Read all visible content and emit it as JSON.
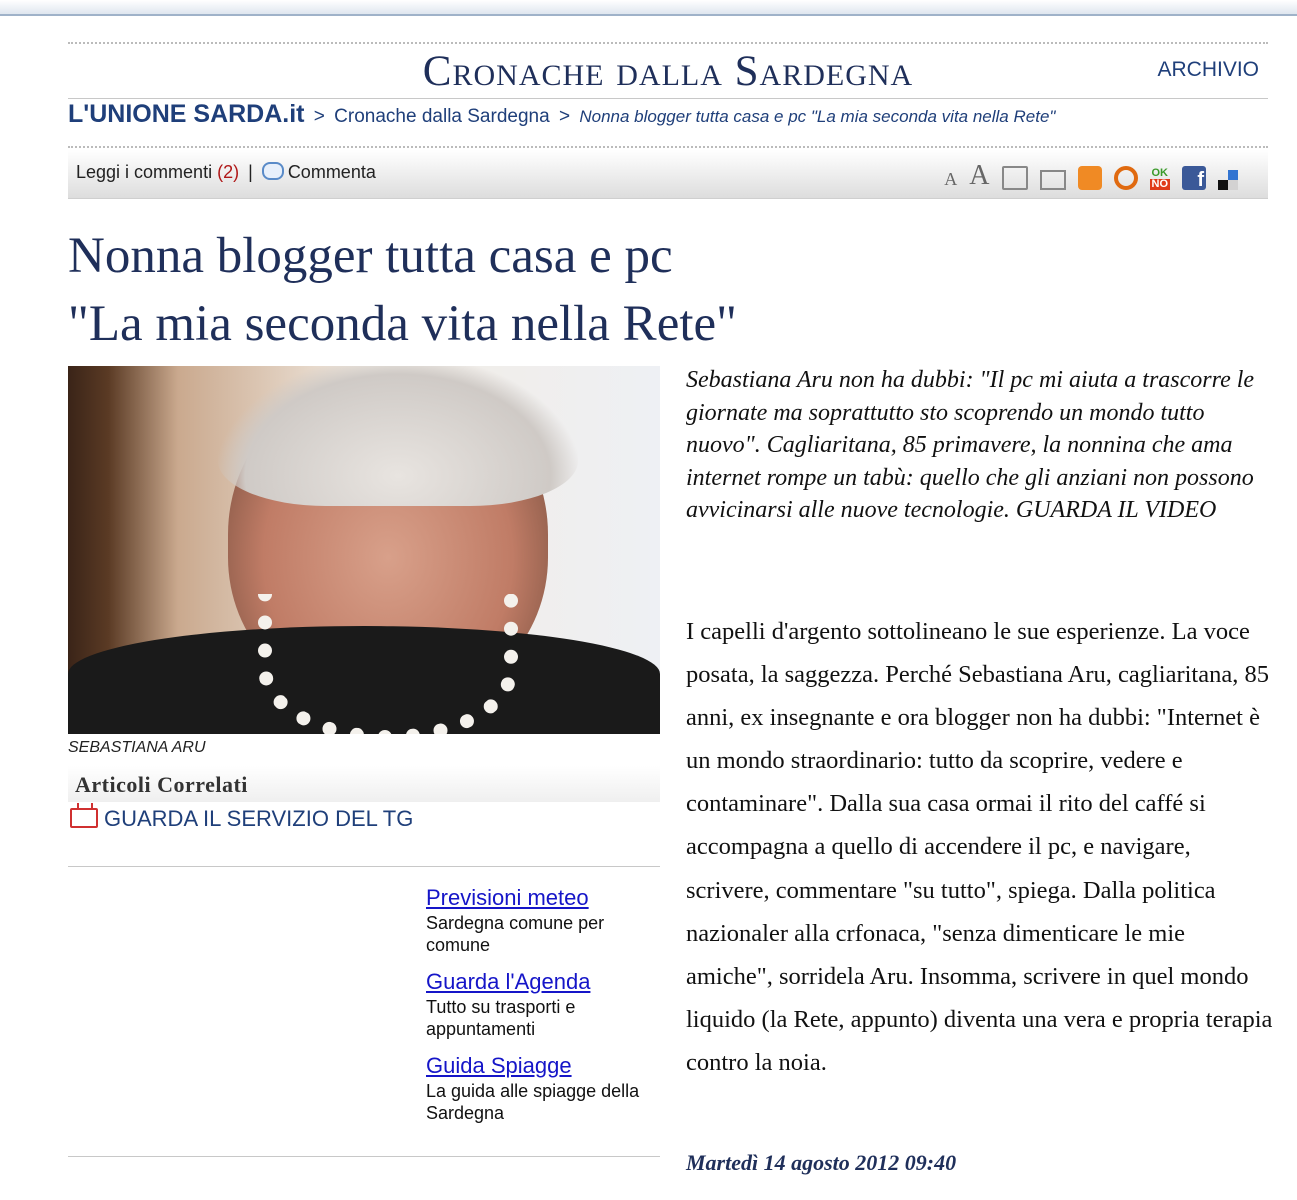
{
  "section": {
    "title": "Cronache dalla Sardegna",
    "archive_label": "ARCHIVIO"
  },
  "breadcrumb": {
    "brand": "L'UNIONE SARDA.it",
    "separator": ">",
    "section": "Cronache dalla Sardegna",
    "current": "Nonna blogger tutta casa e pc \"La mia seconda vita nella Rete\""
  },
  "toolbar": {
    "read_comments": "Leggi i commenti",
    "comment_count": "(2)",
    "pipe": "|",
    "comment": "Commenta",
    "font_small": "A",
    "font_large": "A",
    "ok": "OK",
    "no": "NO",
    "fb": "f",
    "icons": [
      "font-decrease-icon",
      "font-increase-icon",
      "print-icon",
      "mail-icon",
      "rss-icon",
      "feed-icon",
      "okno-icon",
      "facebook-icon",
      "delicious-icon"
    ]
  },
  "headline": {
    "line1": "Nonna blogger tutta casa e pc",
    "line2": "\"La mia seconda vita nella Rete\""
  },
  "photo": {
    "caption": "SEBASTIANA ARU"
  },
  "related": {
    "title": "Articoli Correlati",
    "item": "GUARDA IL SERVIZIO DEL TG"
  },
  "services": [
    {
      "link": "Previsioni meteo",
      "desc": "Sardegna comune per comune"
    },
    {
      "link": "Guarda l'Agenda",
      "desc": "Tutto su trasporti e appuntamenti"
    },
    {
      "link": "Guida Spiagge",
      "desc": "La guida alle spiagge della Sardegna"
    }
  ],
  "article": {
    "summary": "Sebastiana Aru non ha dubbi: \"Il pc mi aiuta a trascorre le giornate ma soprattutto sto scoprendo un mondo tutto nuovo\". Cagliaritana, 85 primavere, la nonnina che ama internet rompe un tabù: quello che gli anziani non possono avvicinarsi alle nuove tecnologie. GUARDA IL VIDEO",
    "body": "I capelli d'argento sottolineano le sue esperienze. La voce posata, la saggezza. Perché Sebastiana Aru, cagliaritana, 85 anni, ex insegnante e ora blogger non ha dubbi: \"Internet è un mondo straordinario: tutto da scoprire, vedere e contaminare\". Dalla sua casa ormai il rito del caffé si accompagna a quello di accendere il pc, e navigare, scrivere, commentare \"su tutto\", spiega. Dalla politica nazionaler alla crfonaca, \"senza dimenticare le mie amiche\", sorridela Aru. Insomma, scrivere in quel mondo liquido (la Rete, appunto) diventa una vera e propria terapia contro la noia.",
    "dateline": "Martedì 14 agosto 2012 09:40"
  },
  "colors": {
    "navy": "#1f2f5a",
    "link_blue": "#1515c8",
    "count_red": "#b01818"
  }
}
